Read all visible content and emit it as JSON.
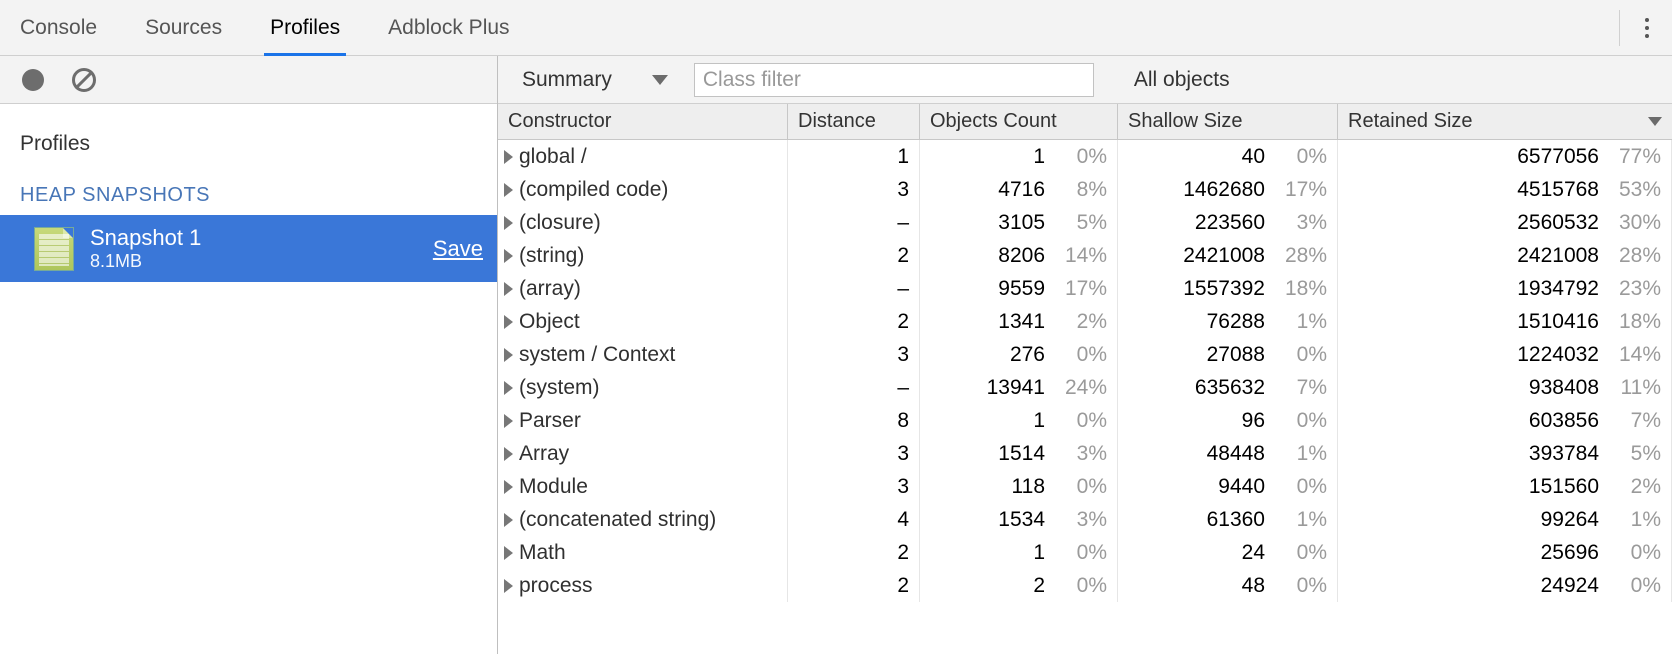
{
  "tabs": {
    "items": [
      "Console",
      "Sources",
      "Profiles",
      "Adblock Plus"
    ],
    "active": 2
  },
  "sidebar": {
    "profiles_label": "Profiles",
    "heap_label": "HEAP SNAPSHOTS",
    "snapshot": {
      "title": "Snapshot 1",
      "size": "8.1MB",
      "save_label": "Save"
    }
  },
  "toolbar": {
    "view_dropdown": "Summary",
    "filter_placeholder": "Class filter",
    "scope_dropdown": "All objects"
  },
  "table": {
    "headers": {
      "constructor": "Constructor",
      "distance": "Distance",
      "count": "Objects Count",
      "shallow": "Shallow Size",
      "retained": "Retained Size"
    },
    "rows": [
      {
        "ctor": "global /",
        "dist": "1",
        "count": "1",
        "count_pct": "0%",
        "shallow": "40",
        "shallow_pct": "0%",
        "retained": "6577056",
        "retained_pct": "77%"
      },
      {
        "ctor": "(compiled code)",
        "dist": "3",
        "count": "4716",
        "count_pct": "8%",
        "shallow": "1462680",
        "shallow_pct": "17%",
        "retained": "4515768",
        "retained_pct": "53%"
      },
      {
        "ctor": "(closure)",
        "dist": "–",
        "count": "3105",
        "count_pct": "5%",
        "shallow": "223560",
        "shallow_pct": "3%",
        "retained": "2560532",
        "retained_pct": "30%"
      },
      {
        "ctor": "(string)",
        "dist": "2",
        "count": "8206",
        "count_pct": "14%",
        "shallow": "2421008",
        "shallow_pct": "28%",
        "retained": "2421008",
        "retained_pct": "28%"
      },
      {
        "ctor": "(array)",
        "dist": "–",
        "count": "9559",
        "count_pct": "17%",
        "shallow": "1557392",
        "shallow_pct": "18%",
        "retained": "1934792",
        "retained_pct": "23%"
      },
      {
        "ctor": "Object",
        "dist": "2",
        "count": "1341",
        "count_pct": "2%",
        "shallow": "76288",
        "shallow_pct": "1%",
        "retained": "1510416",
        "retained_pct": "18%"
      },
      {
        "ctor": "system / Context",
        "dist": "3",
        "count": "276",
        "count_pct": "0%",
        "shallow": "27088",
        "shallow_pct": "0%",
        "retained": "1224032",
        "retained_pct": "14%"
      },
      {
        "ctor": "(system)",
        "dist": "–",
        "count": "13941",
        "count_pct": "24%",
        "shallow": "635632",
        "shallow_pct": "7%",
        "retained": "938408",
        "retained_pct": "11%"
      },
      {
        "ctor": "Parser",
        "dist": "8",
        "count": "1",
        "count_pct": "0%",
        "shallow": "96",
        "shallow_pct": "0%",
        "retained": "603856",
        "retained_pct": "7%"
      },
      {
        "ctor": "Array",
        "dist": "3",
        "count": "1514",
        "count_pct": "3%",
        "shallow": "48448",
        "shallow_pct": "1%",
        "retained": "393784",
        "retained_pct": "5%"
      },
      {
        "ctor": "Module",
        "dist": "3",
        "count": "118",
        "count_pct": "0%",
        "shallow": "9440",
        "shallow_pct": "0%",
        "retained": "151560",
        "retained_pct": "2%"
      },
      {
        "ctor": "(concatenated string)",
        "dist": "4",
        "count": "1534",
        "count_pct": "3%",
        "shallow": "61360",
        "shallow_pct": "1%",
        "retained": "99264",
        "retained_pct": "1%"
      },
      {
        "ctor": "Math",
        "dist": "2",
        "count": "1",
        "count_pct": "0%",
        "shallow": "24",
        "shallow_pct": "0%",
        "retained": "25696",
        "retained_pct": "0%"
      },
      {
        "ctor": "process",
        "dist": "2",
        "count": "2",
        "count_pct": "0%",
        "shallow": "48",
        "shallow_pct": "0%",
        "retained": "24924",
        "retained_pct": "0%"
      }
    ]
  }
}
